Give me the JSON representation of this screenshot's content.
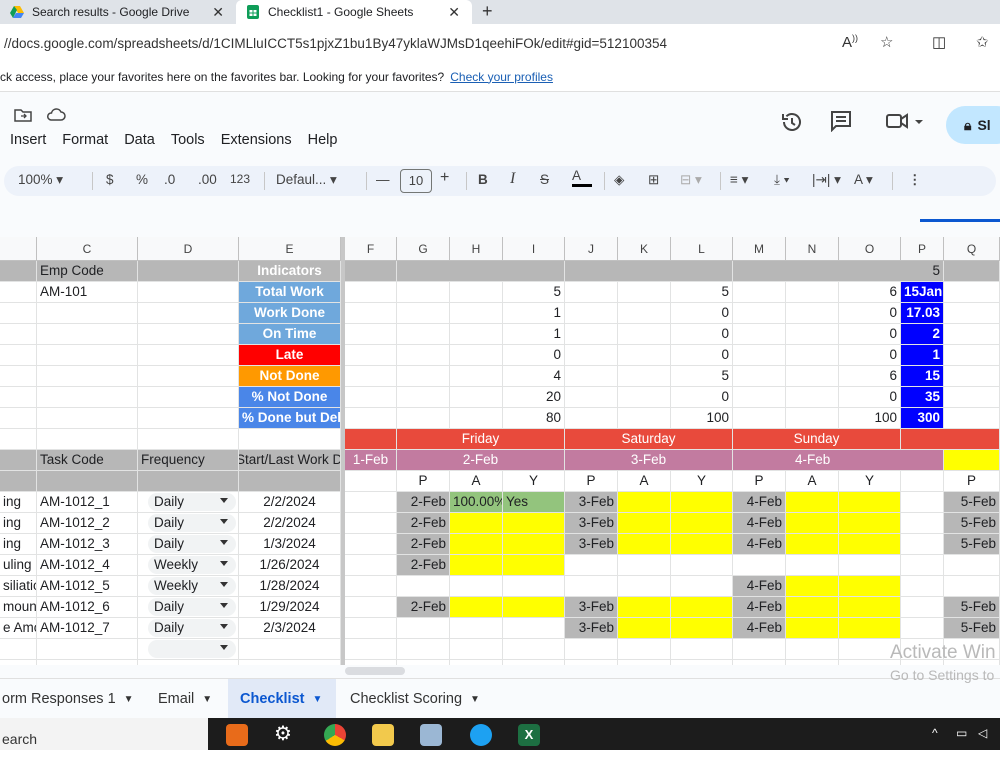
{
  "browser": {
    "tabs": [
      {
        "label": "Search results - Google Drive"
      },
      {
        "label": "Checklist1 - Google Sheets"
      }
    ],
    "url": "//docs.google.com/spreadsheets/d/1CIMLluICCT5s1pjxZ1bu1By47yklaWJMsD1qeehiFOk/edit#gid=512100354",
    "fav_text": "ck access, place your favorites here on the favorites bar. Looking for your favorites?",
    "fav_link": "Check your profiles"
  },
  "menus": [
    "Insert",
    "Format",
    "Data",
    "Tools",
    "Extensions",
    "Help"
  ],
  "share_label": "Sl",
  "toolbar": {
    "zoom": "100%",
    "currency": "$",
    "percent": "%",
    "dec_dec": ".0",
    "dec_inc": ".00",
    "format123": "123",
    "font": "Defaul...",
    "font_size": "10",
    "bold": "B",
    "italic": "I"
  },
  "columns": [
    "C",
    "D",
    "E",
    "F",
    "G",
    "H",
    "I",
    "J",
    "K",
    "L",
    "M",
    "N",
    "O",
    "P",
    "Q"
  ],
  "rows": {
    "r1": {
      "c": "Emp Code",
      "e": "Indicators",
      "p": "5"
    },
    "r2": {
      "c": "AM-101",
      "e": "Total Work",
      "i": "5",
      "l": "5",
      "o": "6",
      "p": "15Jan"
    },
    "r3": {
      "e": "Work Done",
      "i": "1",
      "l": "0",
      "o": "0",
      "p": "17.03"
    },
    "r4": {
      "e": "On Time",
      "i": "1",
      "l": "0",
      "o": "0",
      "p": "2"
    },
    "r5": {
      "e": "Late",
      "i": "0",
      "l": "0",
      "o": "0",
      "p": "1"
    },
    "r6": {
      "e": "Not Done",
      "i": "4",
      "l": "5",
      "o": "6",
      "p": "15"
    },
    "r7": {
      "e": "% Not Done",
      "i": "20",
      "l": "0",
      "o": "0",
      "p": "35"
    },
    "r8": {
      "e": "% Done but Delay",
      "i": "80",
      "l": "100",
      "o": "100",
      "p": "300"
    },
    "r9": {
      "h": "Friday",
      "k": "Saturday",
      "n": "Sunday"
    },
    "r10": {
      "c": "Task Code",
      "d": "Frequency",
      "e": "Start/Last Work Date",
      "f": "1-Feb",
      "h": "2-Feb",
      "k": "3-Feb",
      "n": "4-Feb"
    },
    "r11": {
      "g": "P",
      "h": "A",
      "i": "Y",
      "j": "P",
      "k": "A",
      "l": "Y",
      "m": "P",
      "n": "A",
      "o": "Y",
      "q": "P"
    }
  },
  "tasks": [
    {
      "b": "ing",
      "c": "AM-1012_1",
      "d": "Daily",
      "e": "2/2/2024",
      "g": "2-Feb",
      "h": "100.00%",
      "i": "Yes",
      "j": "3-Feb",
      "m": "4-Feb",
      "q": "5-Feb"
    },
    {
      "b": "ing",
      "c": "AM-1012_2",
      "d": "Daily",
      "e": "2/2/2024",
      "g": "2-Feb",
      "j": "3-Feb",
      "m": "4-Feb",
      "q": "5-Feb"
    },
    {
      "b": "ing",
      "c": "AM-1012_3",
      "d": "Daily",
      "e": "1/3/2024",
      "g": "2-Feb",
      "j": "3-Feb",
      "m": "4-Feb",
      "q": "5-Feb"
    },
    {
      "b": "uling",
      "c": "AM-1012_4",
      "d": "Weekly",
      "e": "1/26/2024",
      "g": "2-Feb"
    },
    {
      "b": "siliatio",
      "c": "AM-1012_5",
      "d": "Weekly",
      "e": "1/28/2024",
      "m": "4-Feb"
    },
    {
      "b": "mount",
      "c": "AM-1012_6",
      "d": "Daily",
      "e": "1/29/2024",
      "g": "2-Feb",
      "j": "3-Feb",
      "m": "4-Feb",
      "q": "5-Feb"
    },
    {
      "b": "e Amo",
      "c": "AM-1012_7",
      "d": "Daily",
      "e": "2/3/2024",
      "j": "3-Feb",
      "m": "4-Feb",
      "q": "5-Feb"
    }
  ],
  "sheet_tabs": [
    {
      "label": "orm Responses 1"
    },
    {
      "label": "Email"
    },
    {
      "label": "Checklist"
    },
    {
      "label": "Checklist Scoring"
    }
  ],
  "watermark": {
    "line1": "Activate Win",
    "line2": "Go to Settings to"
  },
  "taskbar_search": "earch",
  "colors": {
    "blue_label": "#6fa8dc",
    "red": "#ff0000",
    "orange": "#ff9900",
    "blue_pct": "#4a86e8",
    "header_red": "#e84a3c",
    "pink": "#c27ba0",
    "yellow": "#ffff00",
    "green": "#93c47d",
    "bright_blue": "#0000ff",
    "gray": "#b7b7b7"
  }
}
